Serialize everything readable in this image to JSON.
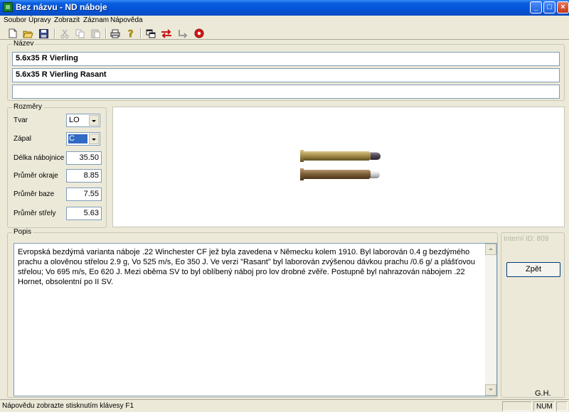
{
  "window": {
    "title": "Bez názvu - ND náboje"
  },
  "menu": [
    "Soubor",
    "Úpravy",
    "Zobrazit",
    "Záznam",
    "Nápověda"
  ],
  "nazev": {
    "label": "Název",
    "line1": "5.6x35 R Vierling",
    "line2": "5.6x35 R Vierling Rasant",
    "line3": ""
  },
  "rozmery": {
    "label": "Rozměry",
    "tvar_label": "Tvar",
    "tvar_value": "LO",
    "zapal_label": "Zápal",
    "zapal_value": "C",
    "delka_label": "Délka nábojnice",
    "delka_value": "35.50",
    "okraj_label": "Průměr okraje",
    "okraj_value": "8.85",
    "baze_label": "Průměr baze",
    "baze_value": "7.55",
    "strela_label": "Průměr střely",
    "strela_value": "5.63"
  },
  "popis": {
    "label": "Popis",
    "text": "Evropská bezdýmá varianta náboje .22 Winchester CF jež byla zavedena v Německu kolem 1910. Byl laborován 0.4 g bezdýmého prachu a olověnou střelou 2.9 g, Vo 525 m/s, Eo 350 J. Ve verzi \"Rasant\" byl laborován zvýšenou dávkou prachu /0.6 g/ a plášťovou střelou; Vo 695 m/s, Eo 620 J. Mezi oběma SV to byl oblíbený náboj pro lov drobné zvěře. Postupně byl nahrazován nábojem .22 Hornet, obsolentní po II SV."
  },
  "side": {
    "internal_id": "Interní ID: 809",
    "back_button": "Zpět",
    "author": "G.H."
  },
  "status": {
    "hint": "Nápovědu zobrazte stisknutím klávesy F1",
    "num": "NUM"
  },
  "colors": {
    "titlebar": "#0453d8",
    "face": "#ece9d8",
    "field_border": "#7f9db9",
    "selection": "#316ac5"
  }
}
